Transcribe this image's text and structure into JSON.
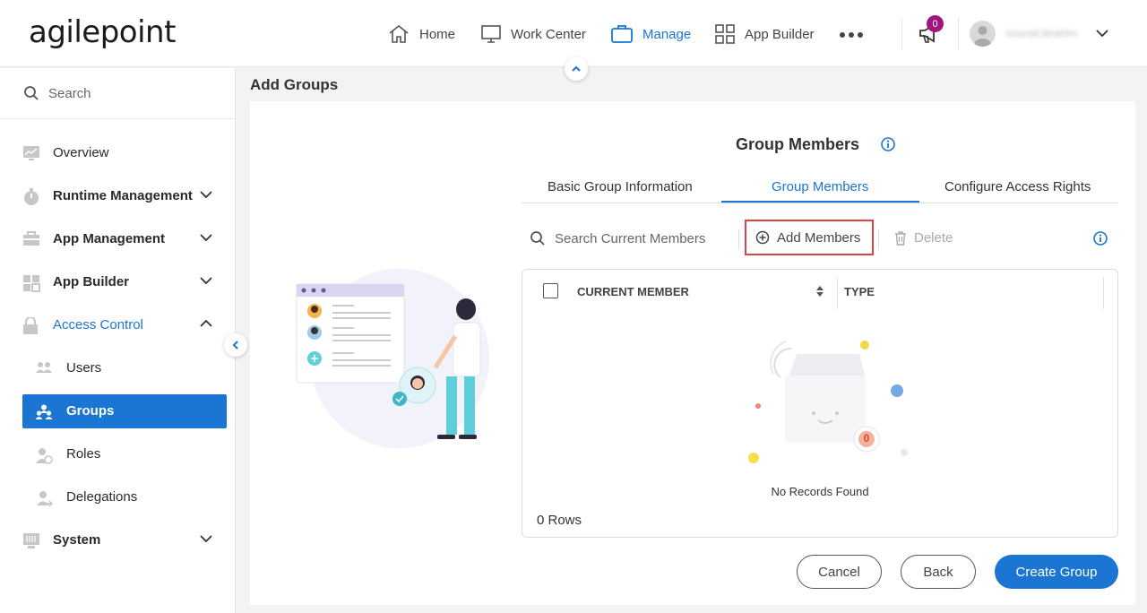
{
  "brand": {
    "logo_text": "agilepoint",
    "accent": "#1a76d2"
  },
  "topnav": {
    "items": [
      {
        "label": "Home",
        "icon": "home-icon"
      },
      {
        "label": "Work Center",
        "icon": "monitor-icon"
      },
      {
        "label": "Manage",
        "icon": "briefcase-icon",
        "active": true
      },
      {
        "label": "App Builder",
        "icon": "grid-icon"
      }
    ],
    "notification_count": "0",
    "username": "nourad.ibrahim"
  },
  "sidebar": {
    "search_placeholder": "Search",
    "items": [
      {
        "label": "Overview",
        "icon": "chart-icon"
      },
      {
        "label": "Runtime Management",
        "icon": "timer-icon",
        "expandable": true
      },
      {
        "label": "App Management",
        "icon": "toolbox-icon",
        "expandable": true
      },
      {
        "label": "App Builder",
        "icon": "grid-icon",
        "expandable": true
      },
      {
        "label": "Access Control",
        "icon": "lock-icon",
        "expanded": true
      },
      {
        "label": "System",
        "icon": "server-icon",
        "expandable": true
      }
    ],
    "sub_items": [
      {
        "label": "Users",
        "icon": "users-icon"
      },
      {
        "label": "Groups",
        "icon": "groups-icon",
        "selected": true
      },
      {
        "label": "Roles",
        "icon": "role-icon"
      },
      {
        "label": "Delegations",
        "icon": "delegation-icon"
      }
    ]
  },
  "page": {
    "title": "Add Groups",
    "section_title": "Group Members",
    "tabs": [
      {
        "label": "Basic Group Information"
      },
      {
        "label": "Group Members",
        "active": true
      },
      {
        "label": "Configure Access Rights"
      }
    ],
    "toolbar": {
      "search_placeholder": "Search Current Members",
      "add_label": "Add Members",
      "delete_label": "Delete"
    },
    "grid": {
      "columns": [
        "CURRENT MEMBER",
        "TYPE"
      ],
      "empty_text": "No Records Found",
      "empty_badge": "0",
      "row_count_text": "0 Rows"
    },
    "buttons": {
      "cancel": "Cancel",
      "back": "Back",
      "create": "Create Group"
    }
  }
}
